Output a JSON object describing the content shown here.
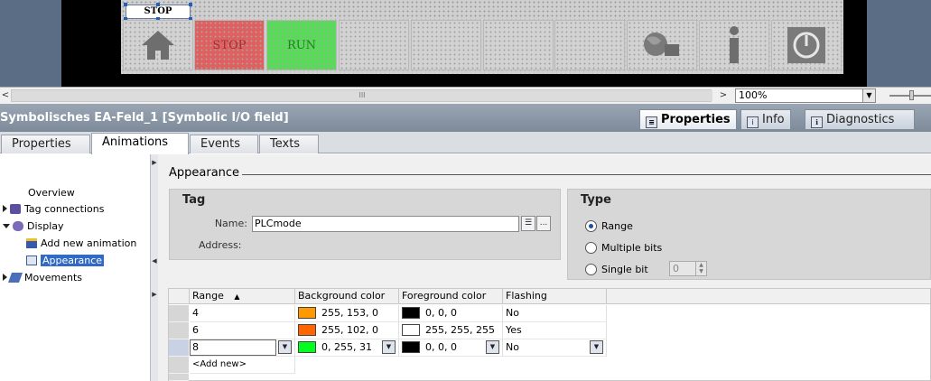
{
  "hmi": {
    "field_label": "STOP",
    "buttons": [
      {
        "name": "home",
        "label": ""
      },
      {
        "name": "stop",
        "label": "STOP"
      },
      {
        "name": "run",
        "label": "RUN"
      },
      {
        "name": "empty-1",
        "label": ""
      },
      {
        "name": "empty-2",
        "label": ""
      },
      {
        "name": "empty-3",
        "label": ""
      },
      {
        "name": "language",
        "label": ""
      },
      {
        "name": "info",
        "label": ""
      },
      {
        "name": "power",
        "label": ""
      }
    ],
    "colors": {
      "stop": "#e06060",
      "run": "#55dd55",
      "screen": "#cfcfcf"
    }
  },
  "scroll": {
    "left_arrow": "<",
    "right_arrow": ">",
    "thumb_grip": "III",
    "zoom": "100%"
  },
  "title_bar": {
    "title": "Symbolisches EA-Feld_1 [Symbolic I/O field]",
    "right_tabs": [
      {
        "label": "Properties",
        "active": true
      },
      {
        "label": "Info",
        "active": false
      },
      {
        "label": "Diagnostics",
        "active": false
      }
    ]
  },
  "tabs": [
    {
      "label": "Properties",
      "active": false
    },
    {
      "label": "Animations",
      "active": true
    },
    {
      "label": "Events",
      "active": false
    },
    {
      "label": "Texts",
      "active": false
    }
  ],
  "tree": [
    {
      "label": "Overview",
      "level": 1
    },
    {
      "label": "Tag connections",
      "level": 0
    },
    {
      "label": "Display",
      "level": 0
    },
    {
      "label": "Add new animation",
      "level": 1
    },
    {
      "label": "Appearance",
      "level": 1,
      "selected": true
    },
    {
      "label": "Movements",
      "level": 0
    }
  ],
  "content": {
    "heading": "Appearance",
    "tag_group": {
      "title": "Tag",
      "name_label": "Name:",
      "name_value": "PLCmode",
      "address_label": "Address:",
      "browse_label": "..."
    },
    "type_group": {
      "title": "Type",
      "options": [
        {
          "label": "Range",
          "selected": true
        },
        {
          "label": "Multiple bits",
          "selected": false
        },
        {
          "label": "Single bit",
          "selected": false
        }
      ],
      "bit_value": "0"
    },
    "table": {
      "headers": [
        "Range",
        "Background color",
        "Foreground color",
        "Flashing"
      ],
      "sort_indicator": "▲",
      "rows": [
        {
          "range": "4",
          "bg_text": "255, 153, 0",
          "bg_color": "#ff9900",
          "fg_text": "0, 0, 0",
          "fg_color": "#000000",
          "flashing": "No"
        },
        {
          "range": "6",
          "bg_text": "255, 102, 0",
          "bg_color": "#ff6600",
          "fg_text": "255, 255, 255",
          "fg_color": "#ffffff",
          "flashing": "Yes"
        },
        {
          "range": "8",
          "bg_text": "0, 255, 31",
          "bg_color": "#00ff1f",
          "fg_text": "0, 0, 0",
          "fg_color": "#000000",
          "flashing": "No"
        }
      ],
      "add_new": "<Add new>"
    }
  }
}
